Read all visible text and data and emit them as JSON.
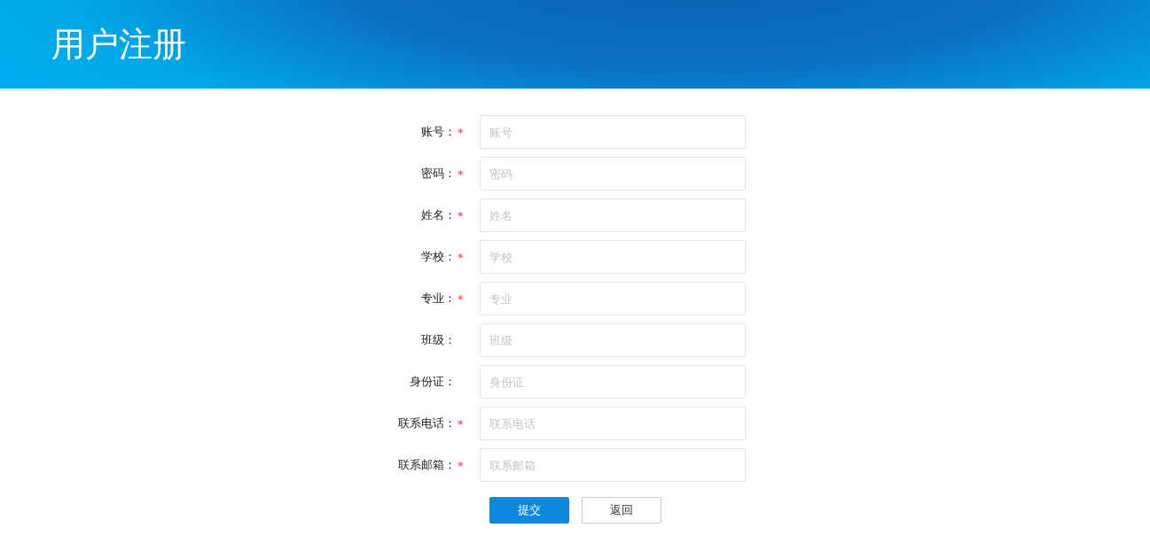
{
  "header": {
    "title": "用户注册"
  },
  "required_mark": "*",
  "fields": [
    {
      "label": "账号：",
      "placeholder": "账号",
      "required": true
    },
    {
      "label": "密码：",
      "placeholder": "密码",
      "required": true
    },
    {
      "label": "姓名：",
      "placeholder": "姓名",
      "required": true
    },
    {
      "label": "学校：",
      "placeholder": "学校",
      "required": true
    },
    {
      "label": "专业：",
      "placeholder": "专业",
      "required": true
    },
    {
      "label": "班级：",
      "placeholder": "班级",
      "required": false
    },
    {
      "label": "身份证：",
      "placeholder": "身份证",
      "required": false
    },
    {
      "label": "联系电话：",
      "placeholder": "联系电话",
      "required": true
    },
    {
      "label": "联系邮箱：",
      "placeholder": "联系邮箱",
      "required": true
    }
  ],
  "buttons": [
    {
      "label": "提交",
      "kind": "primary"
    },
    {
      "label": "返回",
      "kind": "secondary"
    }
  ]
}
